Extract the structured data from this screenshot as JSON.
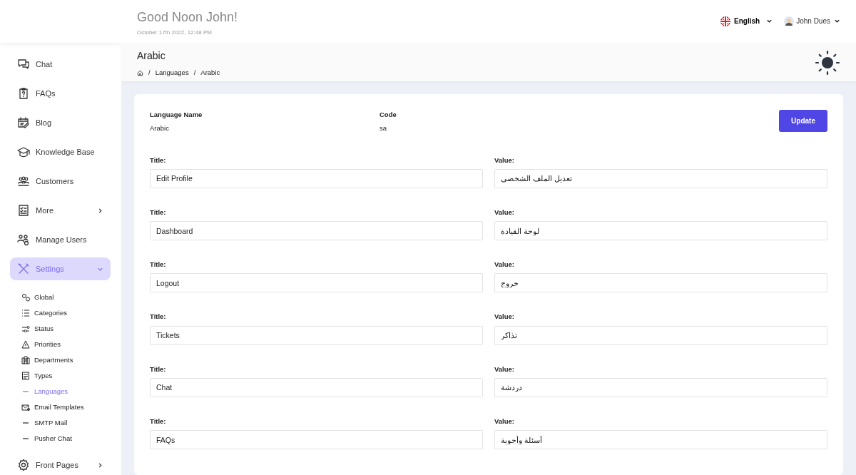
{
  "header": {
    "greeting": "Good Noon John!",
    "datetime": "October 17th 2022, 12:48 PM",
    "language": "English",
    "user": "John Dues"
  },
  "sidebar": {
    "items": [
      {
        "label": "Chat",
        "selected": false
      },
      {
        "label": "FAQs",
        "selected": false
      },
      {
        "label": "Blog",
        "selected": false
      },
      {
        "label": "Knowledge Base",
        "selected": false
      },
      {
        "label": "Customers",
        "selected": false
      },
      {
        "label": "More",
        "selected": false,
        "expanded": false
      },
      {
        "label": "Manage Users",
        "selected": false
      },
      {
        "label": "Settings",
        "selected": true,
        "expanded": true,
        "children": [
          {
            "label": "Global",
            "selected": false
          },
          {
            "label": "Categories",
            "selected": false
          },
          {
            "label": "Status",
            "selected": false
          },
          {
            "label": "Priorities",
            "selected": false
          },
          {
            "label": "Departments",
            "selected": false
          },
          {
            "label": "Types",
            "selected": false
          },
          {
            "label": "Languages",
            "selected": true
          },
          {
            "label": "Email Templates",
            "selected": false
          },
          {
            "label": "SMTP Mail",
            "selected": false
          },
          {
            "label": "Pusher Chat",
            "selected": false
          }
        ]
      },
      {
        "label": "Front Pages",
        "selected": false,
        "expanded": false
      }
    ]
  },
  "page": {
    "title": "Arabic",
    "breadcrumb_separator": "/",
    "breadcrumb": [
      "Languages",
      "Arabic"
    ]
  },
  "language": {
    "name_label": "Language Name",
    "name": "Arabic",
    "code_label": "Code",
    "code": "sa",
    "button": "Update"
  },
  "fields": [
    {
      "title_label": "Title:",
      "title": "Edit Profile",
      "value_label": "Value:",
      "value": "تعديل الملف الشخصي"
    },
    {
      "title_label": "Title:",
      "title": "Dashboard",
      "value_label": "Value:",
      "value": "لوحة القيادة"
    },
    {
      "title_label": "Title:",
      "title": "Logout",
      "value_label": "Value:",
      "value": "خروج"
    },
    {
      "title_label": "Title:",
      "title": "Tickets",
      "value_label": "Value:",
      "value": "تذاكر"
    },
    {
      "title_label": "Title:",
      "title": "Chat",
      "value_label": "Value:",
      "value": "دردشة"
    },
    {
      "title_label": "Title:",
      "title": "FAQs",
      "value_label": "Value:",
      "value": "أسئلة وأجوبة"
    }
  ]
}
